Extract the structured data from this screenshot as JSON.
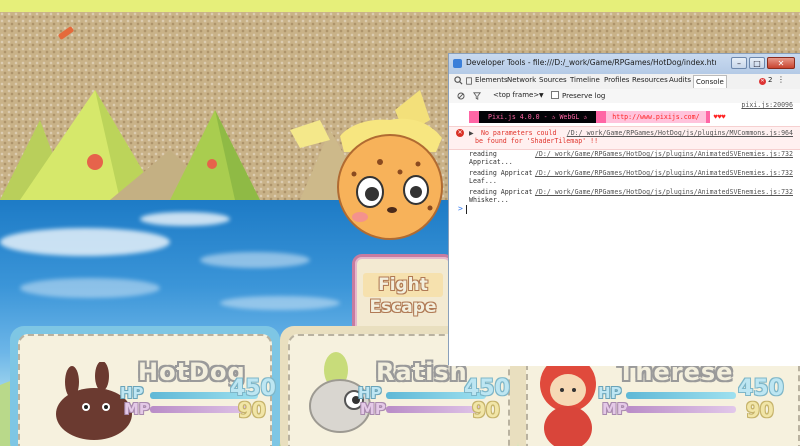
{
  "game": {
    "command_window": {
      "items": [
        "Fight",
        "Escape"
      ],
      "selected": "Fight"
    },
    "heroes": [
      {
        "name": "HotDog",
        "hp_label": "HP",
        "mp_label": "MP",
        "hp": "450",
        "mp": "90",
        "hp_fraction": 1.0,
        "mp_fraction": 1.0
      },
      {
        "name": "Ratish",
        "hp_label": "HP",
        "mp_label": "MP",
        "hp": "450",
        "mp": "90",
        "hp_fraction": 1.0,
        "mp_fraction": 1.0
      },
      {
        "name": "Therese",
        "hp_label": "HP",
        "mp_label": "MP",
        "hp": "450",
        "mp": "90",
        "hp_fraction": 1.0,
        "mp_fraction": 1.0
      }
    ]
  },
  "devtools": {
    "title": "Developer Tools - file:///D:/_work/Game/RPGames/HotDog/index.html?test",
    "tabs": [
      "Elements",
      "Network",
      "Sources",
      "Timeline",
      "Profiles",
      "Resources",
      "Audits",
      "Console"
    ],
    "active_tab": "Console",
    "error_count": "2",
    "toolbar": {
      "frame": "<top frame>",
      "preserve_log": "Preserve log"
    },
    "console": {
      "pixi_banner_text": "Pixi.js 4.0.0 - ✰ WebGL ✰",
      "pixi_url": "http://www.pixijs.com/",
      "pixi_hearts": "♥♥♥",
      "pixi_source": "pixi.js:20096",
      "error_line1": "No parameters could",
      "error_line2": "be found for 'ShaderTilemap' !!",
      "error_source": "/D:/_work/Game/RPGames/HotDog/js/plugins/MVCommons.js:964",
      "logs": [
        {
          "line1": "reading",
          "line2": "Appricat...",
          "source": "/D:/_work/Game/RPGames/HotDog/js/plugins/AnimatedSVEnemies.js:732"
        },
        {
          "line1": "reading Appricat",
          "line2": "Leaf...",
          "source": "/D:/_work/Game/RPGames/HotDog/js/plugins/AnimatedSVEnemies.js:732"
        },
        {
          "line1": "reading Appricat",
          "line2": "Whisker...",
          "source": "/D:/_work/Game/RPGames/HotDog/js/plugins/AnimatedSVEnemies.js:732"
        }
      ],
      "prompt": ">"
    }
  }
}
